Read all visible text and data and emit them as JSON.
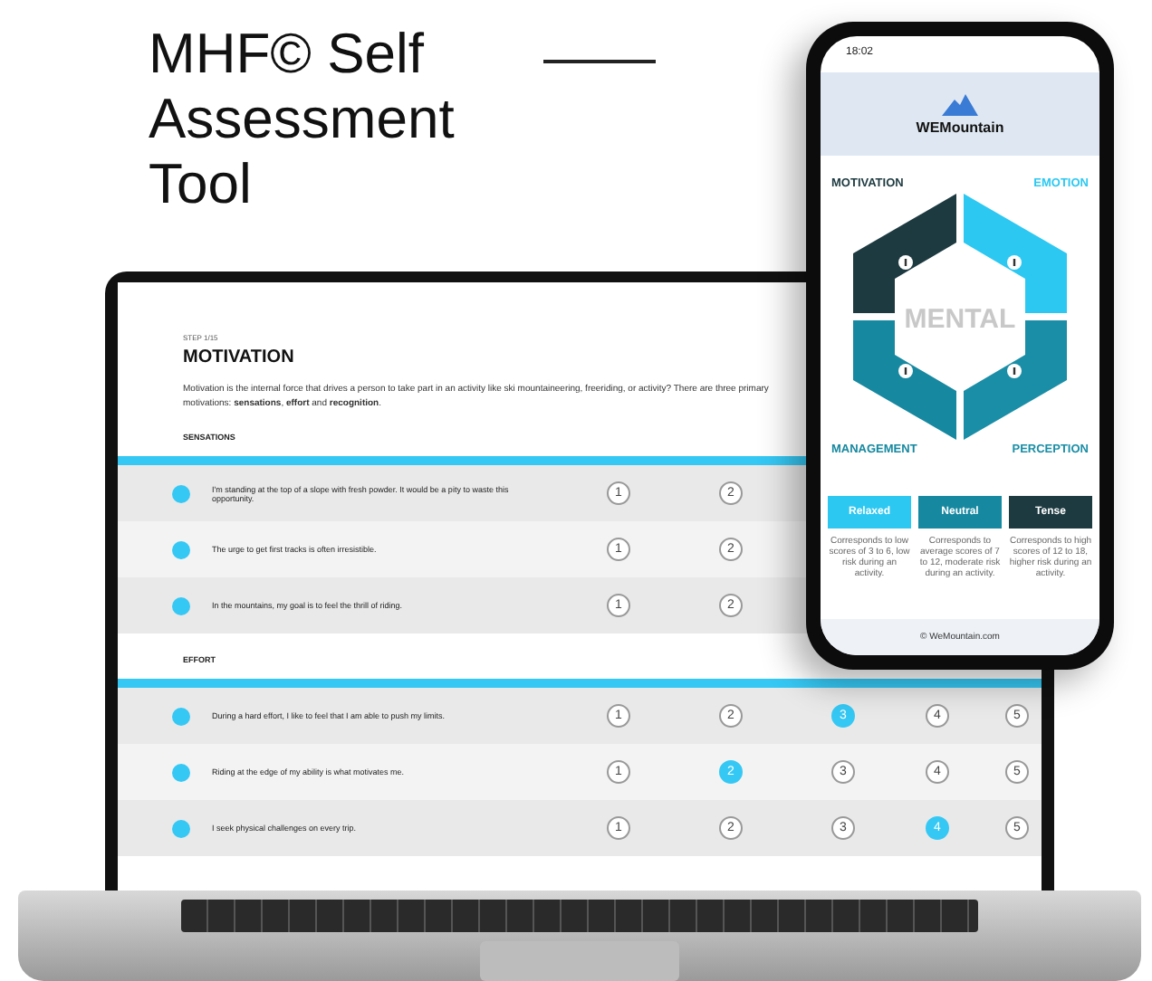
{
  "headline": "MHF© Self Assessment Tool",
  "laptop": {
    "step": "STEP 1/15",
    "title": "MOTIVATION",
    "intro": "Motivation is the internal force that drives a person to take part in an activity like ski mountaineering, freeriding, or activity? There are three primary motivations: **sensations**, **effort** and **recognition**.",
    "sections": [
      {
        "title": "SENSATIONS",
        "rows": [
          {
            "text": "I'm standing at the top of a slope with fresh powder. It would be a pity to waste this opportunity.",
            "ratings": [
              {
                "label": "1",
                "selected": false
              },
              {
                "label": "2",
                "selected": false
              }
            ]
          },
          {
            "text": "The urge to get first tracks is often irresistible.",
            "ratings": [
              {
                "label": "1",
                "selected": false
              },
              {
                "label": "2",
                "selected": false
              }
            ]
          },
          {
            "text": "In the mountains, my goal is to feel the thrill of riding.",
            "ratings": [
              {
                "label": "1",
                "selected": false
              },
              {
                "label": "2",
                "selected": false
              }
            ]
          }
        ]
      },
      {
        "title": "EFFORT",
        "rows": [
          {
            "text": "During a hard effort, I like to feel that I am able to push my limits.",
            "ratings": [
              {
                "label": "1",
                "selected": false
              },
              {
                "label": "2",
                "selected": false
              },
              {
                "label": "3",
                "selected": true
              },
              {
                "label": "4",
                "selected": false
              },
              {
                "label": "5",
                "selected": false
              }
            ]
          },
          {
            "text": "Riding at the edge of my ability is what motivates me.",
            "ratings": [
              {
                "label": "1",
                "selected": false
              },
              {
                "label": "2",
                "selected": true
              },
              {
                "label": "3",
                "selected": false
              },
              {
                "label": "4",
                "selected": false
              },
              {
                "label": "5",
                "selected": false
              }
            ]
          },
          {
            "text": "I seek physical challenges on every trip.",
            "ratings": [
              {
                "label": "1",
                "selected": false
              },
              {
                "label": "2",
                "selected": false
              },
              {
                "label": "3",
                "selected": false
              },
              {
                "label": "4",
                "selected": true
              },
              {
                "label": "5",
                "selected": false
              }
            ]
          }
        ]
      }
    ]
  },
  "phone": {
    "time": "18:02",
    "brand": "WEMountain",
    "center": "MENTAL",
    "segments": [
      {
        "label": "MOTIVATION",
        "color": "#1d3a40"
      },
      {
        "label": "EMOTION",
        "color": "#2cc8f2"
      },
      {
        "label": "MANAGEMENT",
        "color": "#1688a0"
      },
      {
        "label": "PERCEPTION",
        "color": "#1a8ea6"
      }
    ],
    "levels": [
      {
        "label": "Relaxed",
        "color": "#2cc8f2",
        "note": "Corresponds to low scores of 3 to 6, low risk during an activity."
      },
      {
        "label": "Neutral",
        "color": "#1688a0",
        "note": "Corresponds to average scores of 7 to 12, moderate risk during an activity."
      },
      {
        "label": "Tense",
        "color": "#1d3a40",
        "note": "Corresponds to high scores of 12 to 18, higher risk during an activity."
      }
    ],
    "footer": "© WeMountain.com"
  }
}
